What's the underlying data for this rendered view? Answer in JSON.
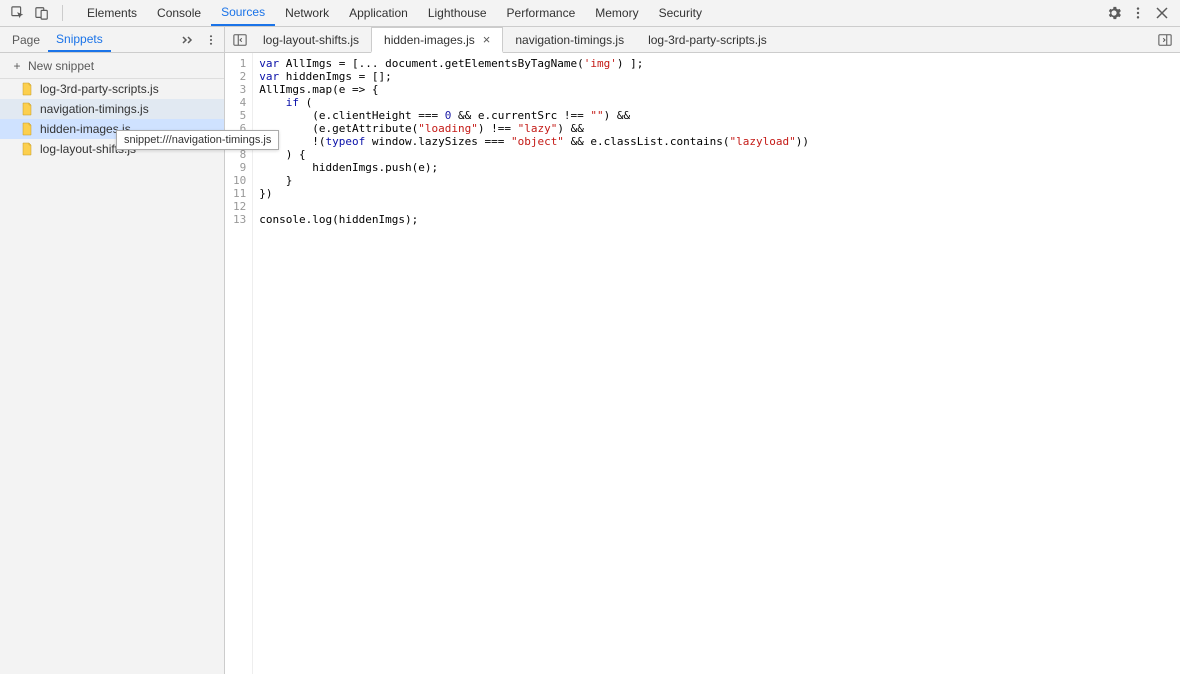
{
  "toolbar": {
    "tabs": [
      "Elements",
      "Console",
      "Sources",
      "Network",
      "Application",
      "Lighthouse",
      "Performance",
      "Memory",
      "Security"
    ],
    "active": "Sources"
  },
  "sidebar": {
    "subtabs": {
      "page": "Page",
      "snippets": "Snippets"
    },
    "new_snippet": "New snippet",
    "items": [
      {
        "name": "log-3rd-party-scripts.js"
      },
      {
        "name": "navigation-timings.js"
      },
      {
        "name": "hidden-images.js"
      },
      {
        "name": "log-layout-shifts.js"
      }
    ],
    "hovered_index": 1,
    "selected_index": 2,
    "tooltip": "snippet:///navigation-timings.js"
  },
  "file_tabs": {
    "items": [
      "log-layout-shifts.js",
      "hidden-images.js",
      "navigation-timings.js",
      "log-3rd-party-scripts.js"
    ],
    "active": "hidden-images.js"
  },
  "code_lines": [
    [
      [
        "kw",
        "var"
      ],
      [
        "ident",
        " AllImgs "
      ],
      [
        "op",
        "="
      ],
      [
        "op",
        " ["
      ],
      [
        "op",
        "... "
      ],
      [
        "ident",
        "document"
      ],
      [
        "op",
        "."
      ],
      [
        "meth",
        "getElementsByTagName"
      ],
      [
        "op",
        "("
      ],
      [
        "str",
        "'img'"
      ],
      [
        "op",
        ") ];"
      ]
    ],
    [
      [
        "kw",
        "var"
      ],
      [
        "ident",
        " hiddenImgs "
      ],
      [
        "op",
        "= [];"
      ]
    ],
    [
      [
        "ident",
        "AllImgs"
      ],
      [
        "op",
        "."
      ],
      [
        "meth",
        "map"
      ],
      [
        "op",
        "("
      ],
      [
        "ident",
        "e"
      ],
      [
        "op",
        " => {"
      ]
    ],
    [
      [
        "op",
        "    "
      ],
      [
        "kw",
        "if"
      ],
      [
        "op",
        " ("
      ]
    ],
    [
      [
        "op",
        "        (e.clientHeight "
      ],
      [
        "op",
        "=== "
      ],
      [
        "num",
        "0"
      ],
      [
        "op",
        " "
      ],
      [
        "op",
        "&&"
      ],
      [
        "op",
        " e.currentSrc "
      ],
      [
        "op",
        "!== "
      ],
      [
        "str",
        "\"\""
      ],
      [
        "op",
        ") "
      ],
      [
        "op",
        "&&"
      ]
    ],
    [
      [
        "op",
        "        (e."
      ],
      [
        "meth",
        "getAttribute"
      ],
      [
        "op",
        "("
      ],
      [
        "str",
        "\"loading\""
      ],
      [
        "op",
        ") "
      ],
      [
        "op",
        "!== "
      ],
      [
        "str",
        "\"lazy\""
      ],
      [
        "op",
        ") "
      ],
      [
        "op",
        "&&"
      ]
    ],
    [
      [
        "op",
        "        !("
      ],
      [
        "kw",
        "typeof"
      ],
      [
        "op",
        " window.lazySizes "
      ],
      [
        "op",
        "=== "
      ],
      [
        "str",
        "\"object\""
      ],
      [
        "op",
        " "
      ],
      [
        "op",
        "&&"
      ],
      [
        "op",
        " e.classList."
      ],
      [
        "meth",
        "contains"
      ],
      [
        "op",
        "("
      ],
      [
        "str",
        "\"lazyload\""
      ],
      [
        "op",
        "))"
      ]
    ],
    [
      [
        "op",
        "    ) {"
      ]
    ],
    [
      [
        "op",
        "        hiddenImgs."
      ],
      [
        "meth",
        "push"
      ],
      [
        "op",
        "(e);"
      ]
    ],
    [
      [
        "op",
        "    }"
      ]
    ],
    [
      [
        "op",
        "})"
      ]
    ],
    [
      [
        "op",
        ""
      ]
    ],
    [
      [
        "ident",
        "console"
      ],
      [
        "op",
        "."
      ],
      [
        "meth",
        "log"
      ],
      [
        "op",
        "(hiddenImgs);"
      ]
    ]
  ]
}
